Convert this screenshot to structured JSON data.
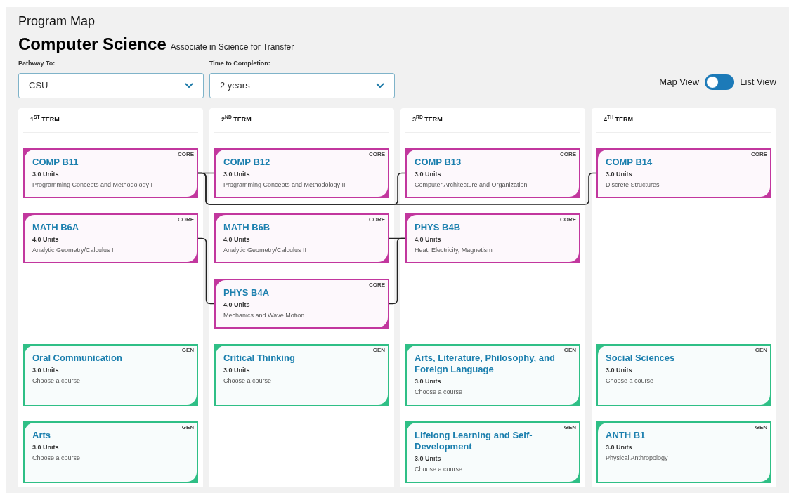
{
  "page_title": "Program Map",
  "program": {
    "name": "Computer Science",
    "degree": "Associate in Science for Transfer"
  },
  "filters": [
    {
      "label": "Pathway To:",
      "value": "CSU"
    },
    {
      "label": "Time to Completion:",
      "value": "2 years"
    }
  ],
  "view_toggle": {
    "left_label": "Map View",
    "right_label": "List View",
    "list_view": false
  },
  "terms": [
    {
      "label": "1$^{ST}$ TERM",
      "core": [
        {
          "code": "COMP B11",
          "units": "3.0 Units",
          "title": "Programming Concepts and Methodology I",
          "badge": "CORE"
        },
        {
          "code": "MATH B6A",
          "units": "4.0 Units",
          "title": "Analytic Geometry/Calculus I",
          "badge": "CORE"
        }
      ],
      "gen": [
        {
          "code": "Oral Communication",
          "units": "3.0 Units",
          "title": "Choose a course",
          "badge": "GEN"
        },
        {
          "code": "Arts",
          "units": "3.0 Units",
          "title": "Choose a course",
          "badge": "GEN"
        }
      ]
    },
    {
      "label": "2$^{ND}$ TERM",
      "core": [
        {
          "code": "COMP B12",
          "units": "3.0 Units",
          "title": "Programming Concepts and Methodology II",
          "badge": "CORE"
        },
        {
          "code": "MATH B6B",
          "units": "4.0 Units",
          "title": "Analytic Geometry/Calculus II",
          "badge": "CORE"
        },
        {
          "code": "PHYS B4A",
          "units": "4.0 Units",
          "title": "Mechanics and Wave Motion",
          "badge": "CORE"
        }
      ],
      "gen": [
        {
          "code": "Critical Thinking",
          "units": "3.0 Units",
          "title": "Choose a course",
          "badge": "GEN"
        }
      ]
    },
    {
      "label": "3$^{RD}$ TERM",
      "core": [
        {
          "code": "COMP B13",
          "units": "3.0 Units",
          "title": "Computer Architecture and Organization",
          "badge": "CORE"
        },
        {
          "code": "PHYS B4B",
          "units": "4.0 Units",
          "title": "Heat, Electricity, Magnetism",
          "badge": "CORE"
        }
      ],
      "gen": [
        {
          "code": "Arts, Literature, Philosophy, and Foreign Language",
          "units": "3.0 Units",
          "title": "Choose a course",
          "badge": "GEN"
        },
        {
          "code": "Lifelong Learning and Self-Development",
          "units": "3.0 Units",
          "title": "Choose a course",
          "badge": "GEN"
        }
      ]
    },
    {
      "label": "4$^{TH}$ TERM",
      "core": [
        {
          "code": "COMP B14",
          "units": "3.0 Units",
          "title": "Discrete Structures",
          "badge": "CORE"
        }
      ],
      "gen": [
        {
          "code": "Social Sciences",
          "units": "3.0 Units",
          "title": "Choose a course",
          "badge": "GEN"
        },
        {
          "code": "ANTH B1",
          "units": "3.0 Units",
          "title": "Physical Anthropology",
          "badge": "GEN"
        }
      ]
    }
  ]
}
